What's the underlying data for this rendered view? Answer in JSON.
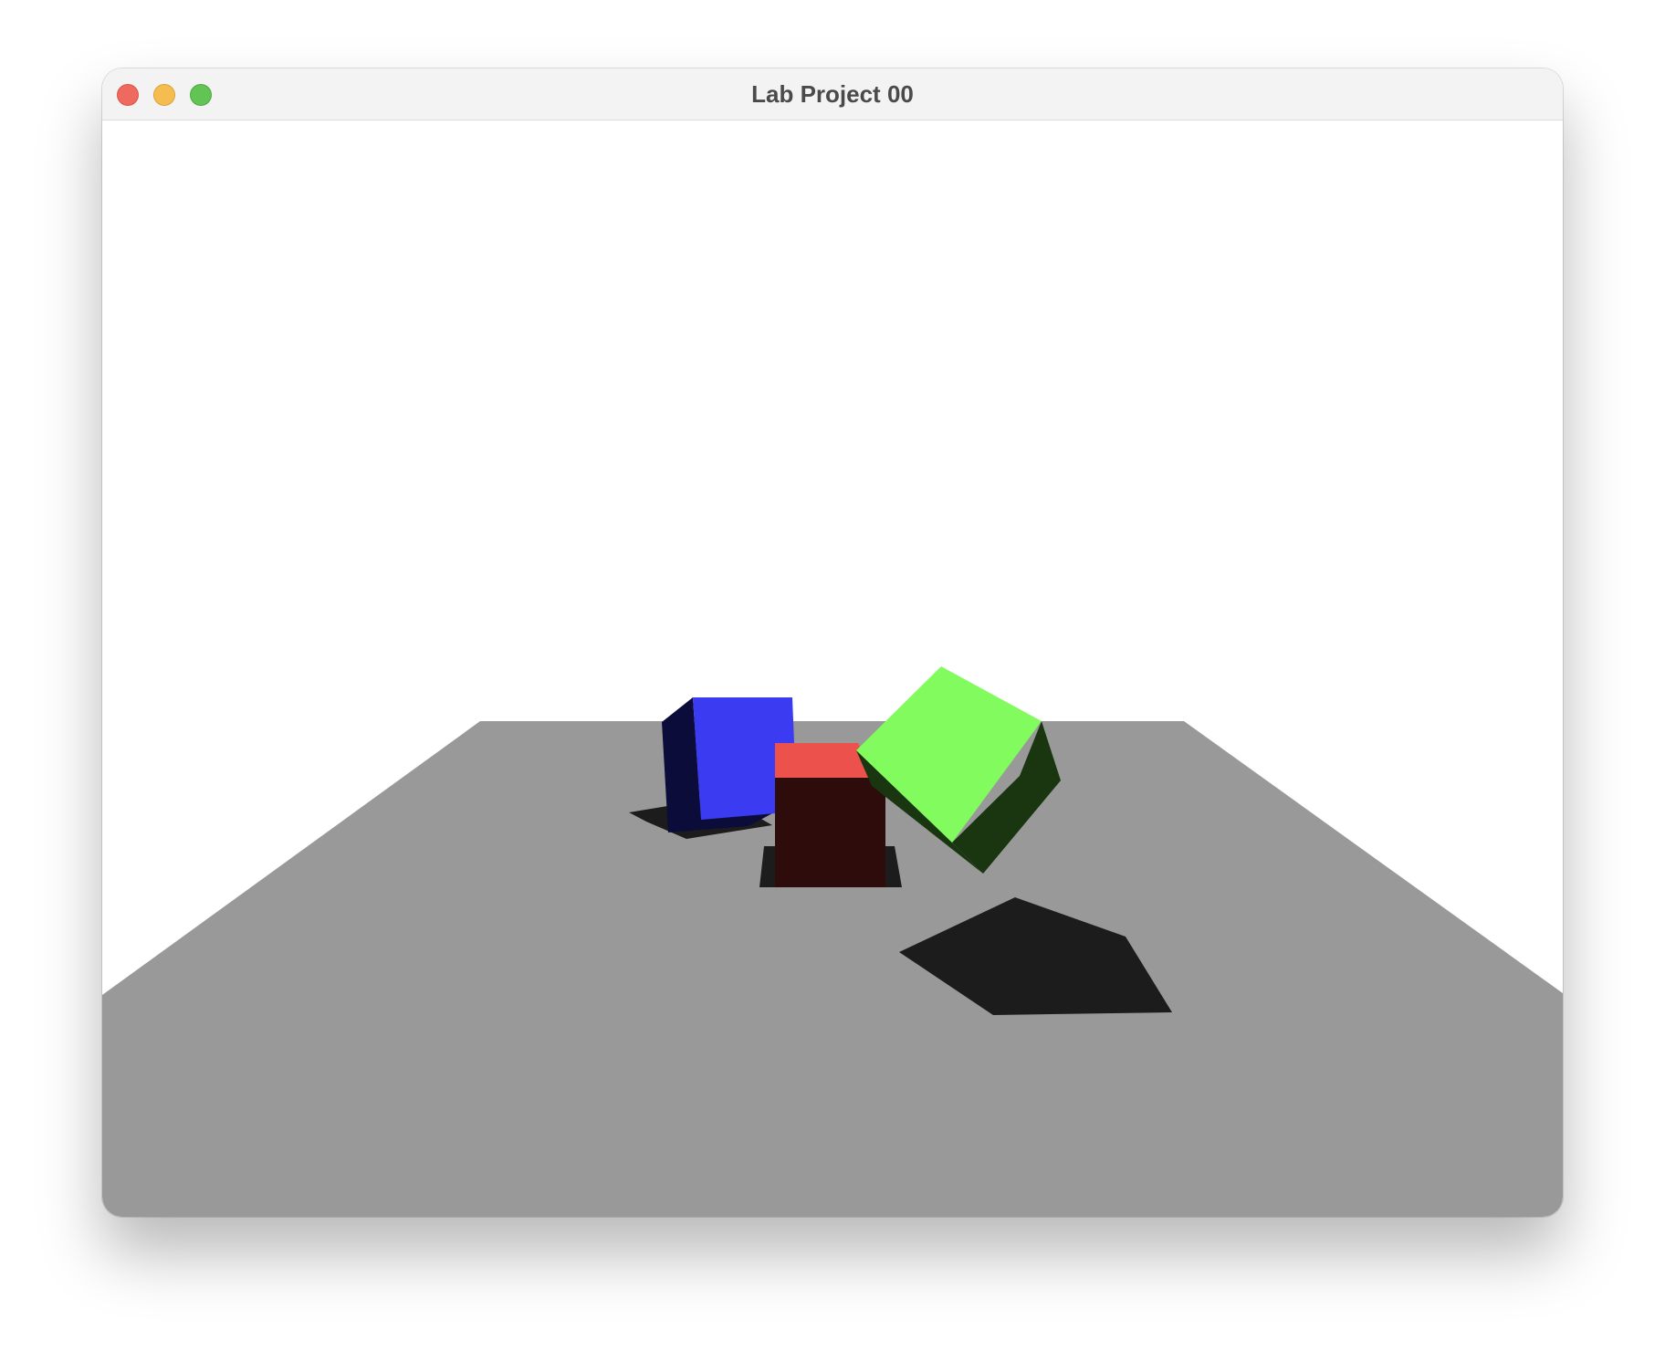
{
  "window": {
    "title": "Lab Project 00",
    "controls": {
      "close_color": "#ee6a5f",
      "minimize_color": "#f5bd4f",
      "maximize_color": "#61c454"
    }
  },
  "scene": {
    "sky_color": "#ffffff",
    "ground_color": "#999999",
    "shadow_color": "#1c1c1c",
    "objects": [
      {
        "name": "blue-cube",
        "color": "#3b3bf2",
        "dark_color": "#0c0c3a"
      },
      {
        "name": "red-cube",
        "color": "#ec524b",
        "dark_color": "#2e0c0c"
      },
      {
        "name": "green-cube",
        "color": "#82fb5e",
        "dark_color": "#193611"
      }
    ]
  }
}
